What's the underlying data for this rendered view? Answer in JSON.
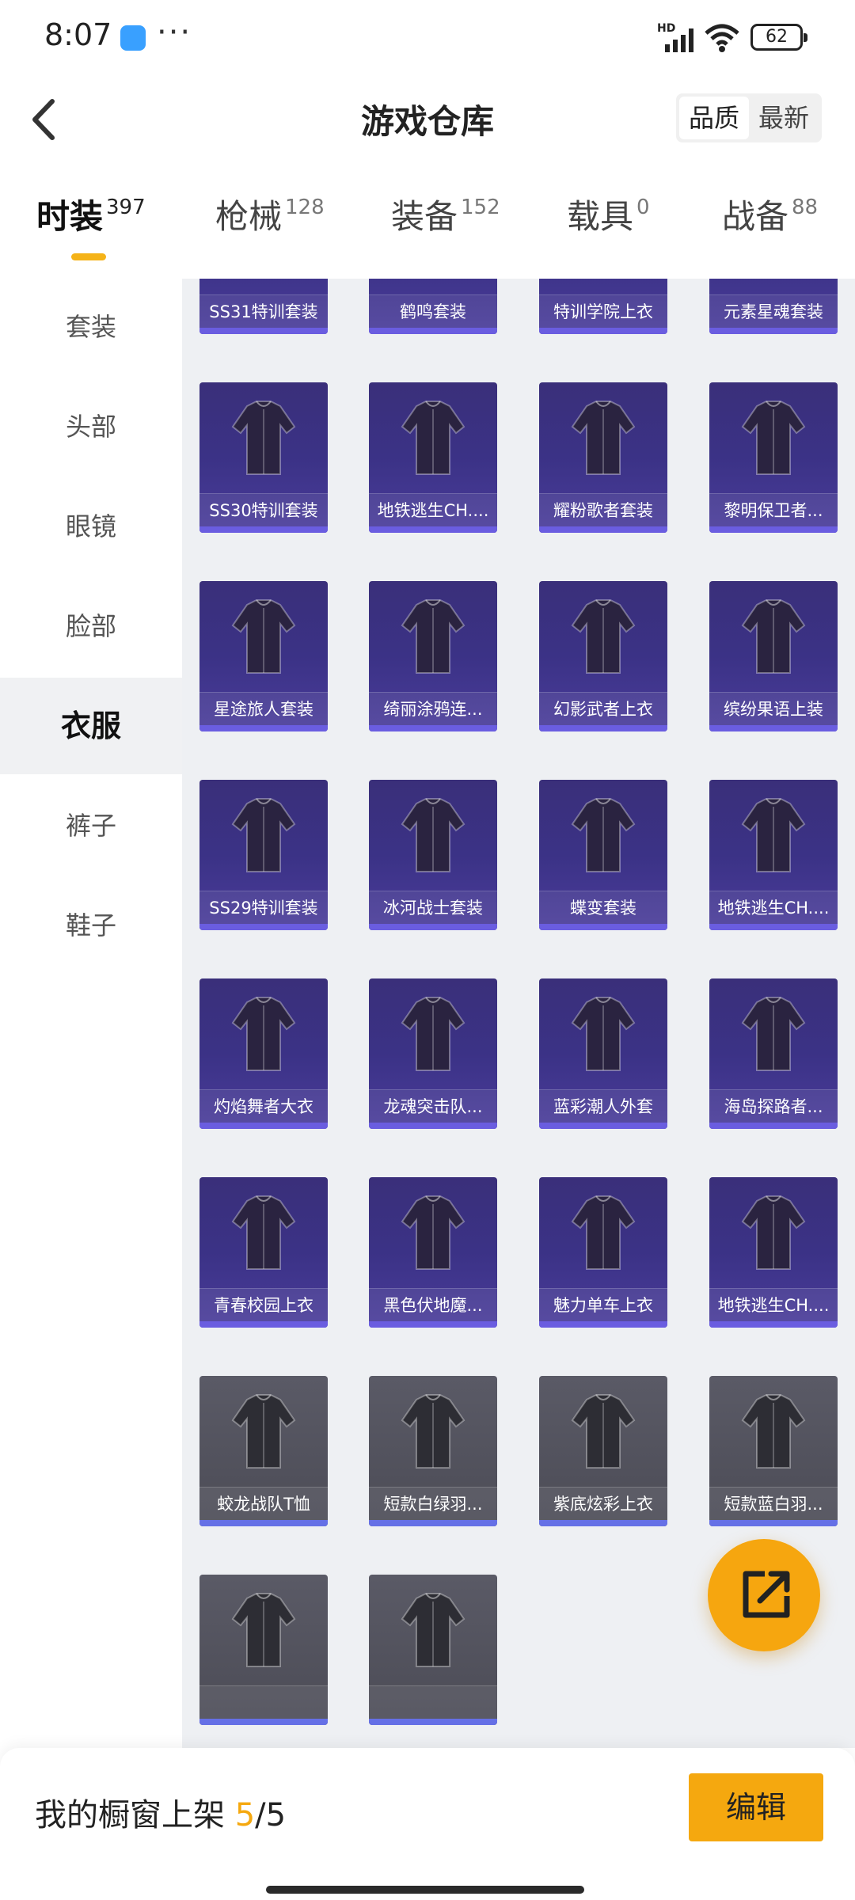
{
  "status_bar": {
    "time": "8:07",
    "hd": "HD",
    "battery": "62",
    "more": "···"
  },
  "header": {
    "title": "游戏仓库",
    "sort_options": [
      "品质",
      "最新"
    ],
    "sort_active": "品质"
  },
  "tabs": [
    {
      "label": "时装",
      "count": "397",
      "active": true
    },
    {
      "label": "枪械",
      "count": "128",
      "active": false
    },
    {
      "label": "装备",
      "count": "152",
      "active": false
    },
    {
      "label": "载具",
      "count": "0",
      "active": false
    },
    {
      "label": "战备",
      "count": "88",
      "active": false
    }
  ],
  "sidebar": {
    "items": [
      {
        "label": "套装",
        "active": false
      },
      {
        "label": "头部",
        "active": false
      },
      {
        "label": "眼镜",
        "active": false
      },
      {
        "label": "脸部",
        "active": false
      },
      {
        "label": "衣服",
        "active": true
      },
      {
        "label": "裤子",
        "active": false
      },
      {
        "label": "鞋子",
        "active": false
      }
    ]
  },
  "items": [
    {
      "name": "SS31特训套装",
      "rarity": "purple"
    },
    {
      "name": "鹤鸣套装",
      "rarity": "purple"
    },
    {
      "name": "特训学院上衣",
      "rarity": "purple"
    },
    {
      "name": "元素星魂套装",
      "rarity": "purple"
    },
    {
      "name": "SS30特训套装",
      "rarity": "purple"
    },
    {
      "name": "地铁逃生CH....",
      "rarity": "purple"
    },
    {
      "name": "耀粉歌者套装",
      "rarity": "purple"
    },
    {
      "name": "黎明保卫者...",
      "rarity": "purple"
    },
    {
      "name": "星途旅人套装",
      "rarity": "purple"
    },
    {
      "name": "绮丽涂鸦连...",
      "rarity": "purple"
    },
    {
      "name": "幻影武者上衣",
      "rarity": "purple"
    },
    {
      "name": "缤纷果语上装",
      "rarity": "purple"
    },
    {
      "name": "SS29特训套装",
      "rarity": "purple"
    },
    {
      "name": "冰河战士套装",
      "rarity": "purple"
    },
    {
      "name": "蝶变套装",
      "rarity": "purple"
    },
    {
      "name": "地铁逃生CH....",
      "rarity": "purple"
    },
    {
      "name": "灼焰舞者大衣",
      "rarity": "purple"
    },
    {
      "name": "龙魂突击队...",
      "rarity": "purple"
    },
    {
      "name": "蓝彩潮人外套",
      "rarity": "purple"
    },
    {
      "name": "海岛探路者...",
      "rarity": "purple"
    },
    {
      "name": "青春校园上衣",
      "rarity": "purple"
    },
    {
      "name": "黑色伏地魔...",
      "rarity": "purple"
    },
    {
      "name": "魅力单车上衣",
      "rarity": "purple"
    },
    {
      "name": "地铁逃生CH....",
      "rarity": "purple"
    },
    {
      "name": "蛟龙战队T恤",
      "rarity": "blue"
    },
    {
      "name": "短款白绿羽...",
      "rarity": "blue"
    },
    {
      "name": "紫底炫彩上衣",
      "rarity": "blue"
    },
    {
      "name": "短款蓝白羽...",
      "rarity": "blue"
    },
    {
      "name": "",
      "rarity": "blue"
    },
    {
      "name": "",
      "rarity": "blue"
    }
  ],
  "bottom_bar": {
    "shelf_label": "我的橱窗上架",
    "shelf_current": "5",
    "shelf_sep": "/",
    "shelf_total": "5",
    "edit_label": "编辑"
  },
  "colors": {
    "accent": "#f5a80f",
    "purple_card": "#3b3286",
    "blue_card": "#4c4c56"
  },
  "icons": {
    "back": "chevron-left-icon",
    "share": "share-icon"
  }
}
